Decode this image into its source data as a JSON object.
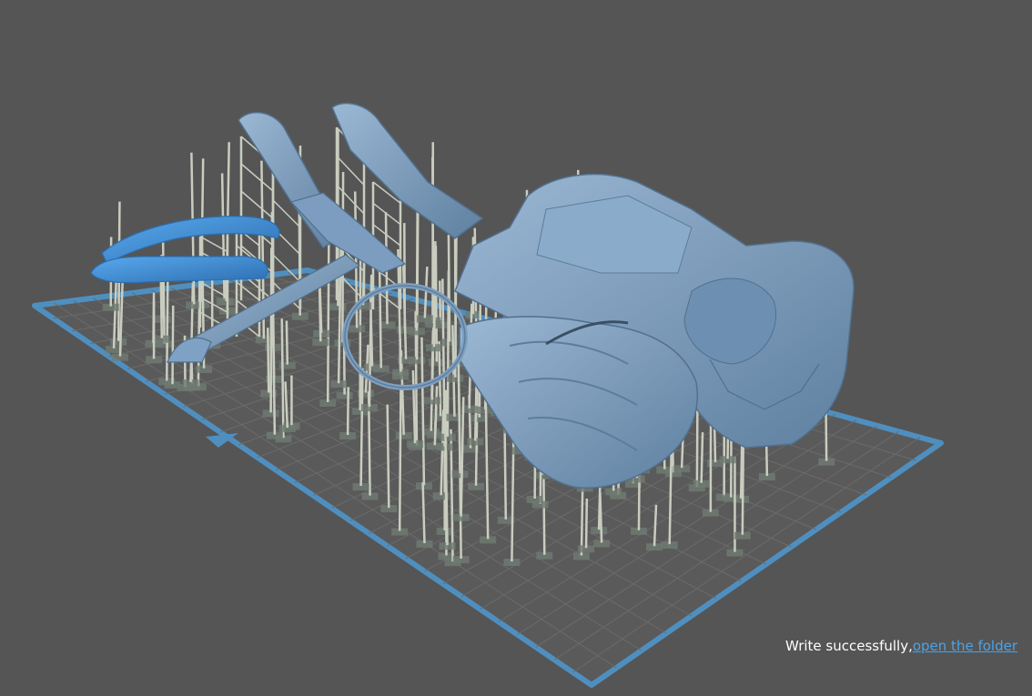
{
  "viewport": {
    "background_color": "#555555",
    "plate_border_color": "#4f8fc0",
    "plate_grid_color": "#6b6b6b",
    "model_color": "#7fa2c4",
    "model_shadow_color": "#5c7d9d",
    "selected_model_color": "#3f8fd6",
    "support_color": "#c9cdbf",
    "support_base_color": "#6f7a72",
    "orientation_marker_icon": "triangle-marker-icon"
  },
  "notification": {
    "message": "Write successfully,",
    "link_label": "open the folder",
    "link_color": "#4aa3e8"
  }
}
